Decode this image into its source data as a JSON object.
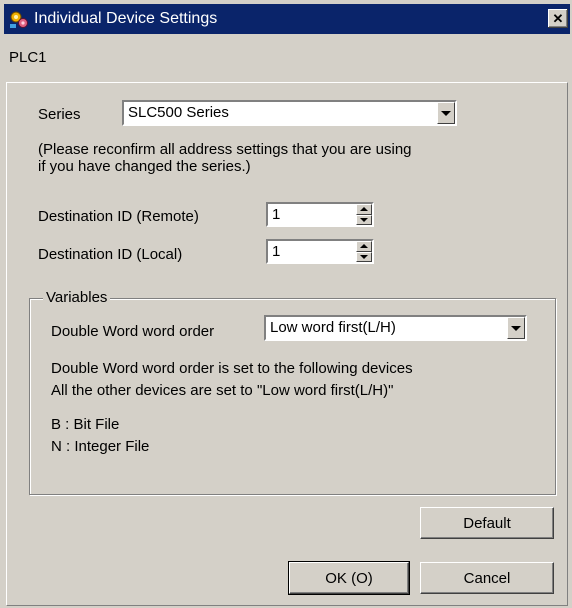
{
  "window": {
    "title": "Individual Device Settings",
    "close_glyph": "✕",
    "icon": "settings-app-icon"
  },
  "plc_label": "PLC1",
  "series": {
    "label": "Series",
    "value": "SLC500 Series"
  },
  "notice": {
    "line1": "(Please reconfirm all address settings that you are using",
    "line2": "if you have changed the series.)"
  },
  "destination_remote": {
    "label": "Destination ID (Remote)",
    "value": "1"
  },
  "destination_local": {
    "label": "Destination ID (Local)",
    "value": "1"
  },
  "variables": {
    "legend": "Variables",
    "dword_label": "Double Word word order",
    "dword_value": "Low word first(L/H)",
    "info_line1": "Double Word word order is set to the following devices",
    "info_line2": "All the other devices are set to \"Low word first(L/H)\"",
    "devices": [
      "B : Bit File",
      "N : Integer File"
    ]
  },
  "buttons": {
    "default": "Default",
    "ok": "OK (O)",
    "cancel": "Cancel"
  }
}
